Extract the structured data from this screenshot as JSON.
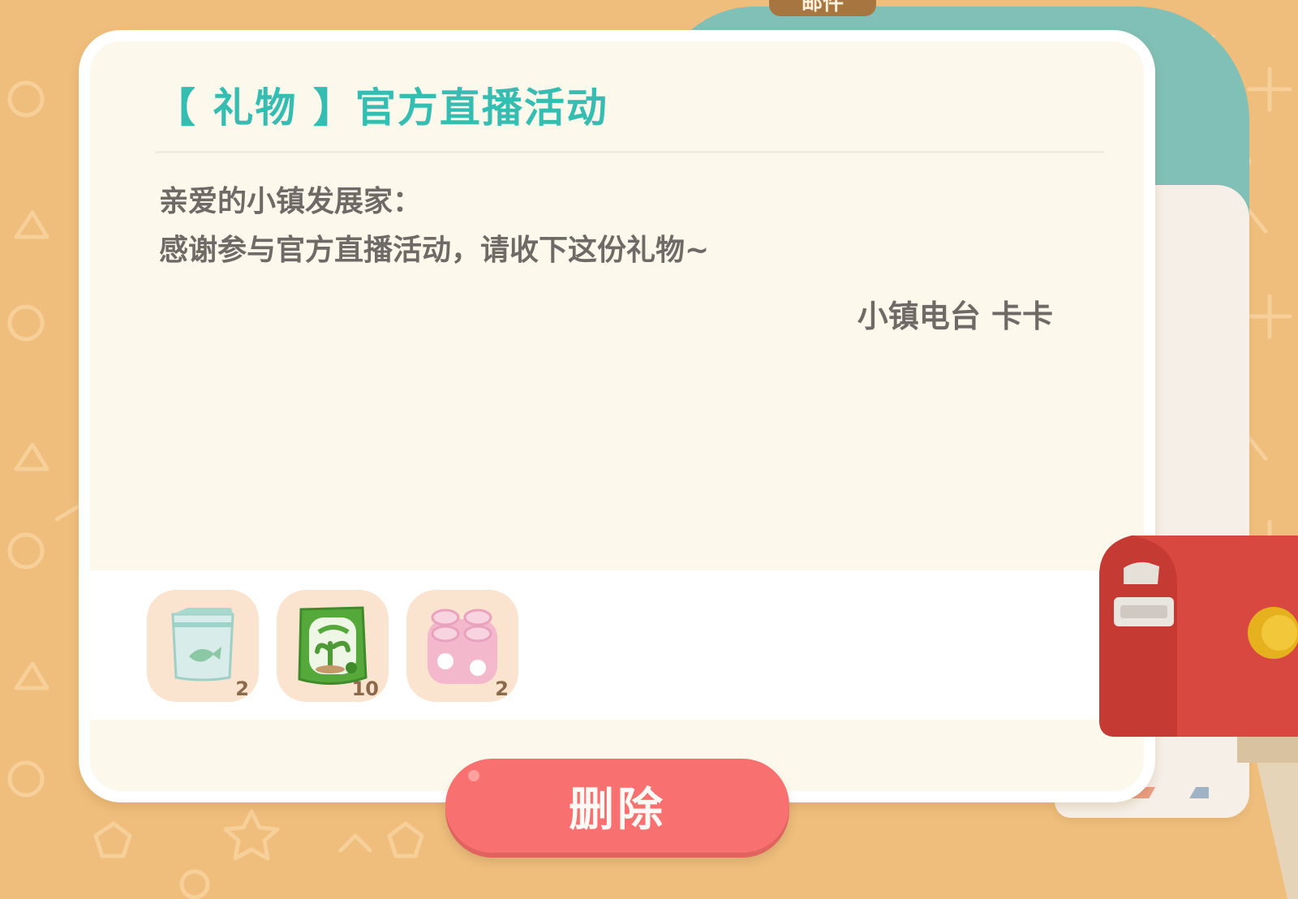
{
  "header": {
    "tab_label": "邮件"
  },
  "mail": {
    "title": "【 礼物 】官方直播活动",
    "greeting": "亲爱的小镇发展家：",
    "message": "感谢参与官方直播活动，请收下这份礼物~",
    "signature": "小镇电台 卡卡"
  },
  "attachments": [
    {
      "icon": "fish-feed-bag-icon",
      "quantity": "2"
    },
    {
      "icon": "fertilizer-bag-icon",
      "quantity": "10"
    },
    {
      "icon": "pink-flower-blocks-icon",
      "quantity": "2"
    }
  ],
  "actions": {
    "delete_label": "删除"
  },
  "colors": {
    "background": "#efbe7c",
    "title": "#36bdb2",
    "body_text": "#6e6a66",
    "delete_button": "#f87170",
    "card": "#fdf8ec"
  }
}
